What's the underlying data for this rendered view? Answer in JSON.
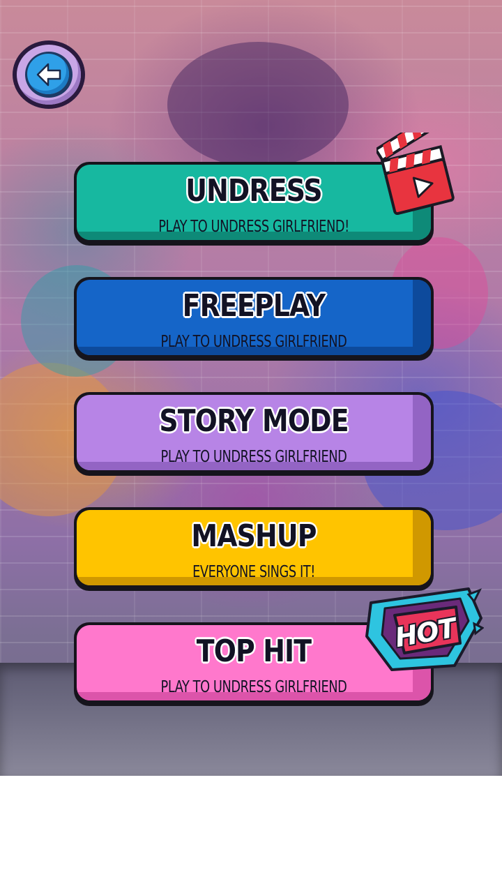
{
  "back_button": {
    "icon": "arrow-left-icon"
  },
  "menu": [
    {
      "key": "undress",
      "title": "UNDRESS",
      "subtitle": "PLAY TO UNDRESS GIRLFRIEND!",
      "color": "#17b8a0",
      "shade": "#0e8a78",
      "badge": "clapperboard-icon"
    },
    {
      "key": "freeplay",
      "title": "FREEPLAY",
      "subtitle": "PLAY TO UNDRESS GIRLFRIEND",
      "color": "#1565c8",
      "shade": "#0d4a9c"
    },
    {
      "key": "story-mode",
      "title": "STORY MODE",
      "subtitle": "PLAY TO UNDRESS GIRLFRIEND",
      "color": "#b784e6",
      "shade": "#9364c4"
    },
    {
      "key": "mashup",
      "title": "MASHUP",
      "subtitle": "EVERYONE SINGS IT!",
      "color": "#ffc400",
      "shade": "#d09800"
    },
    {
      "key": "top-hit",
      "title": "TOP HIT",
      "subtitle": "PLAY TO UNDRESS GIRLFRIEND",
      "color": "#ff78cc",
      "shade": "#dc54aa",
      "badge_text": "HOT"
    }
  ]
}
